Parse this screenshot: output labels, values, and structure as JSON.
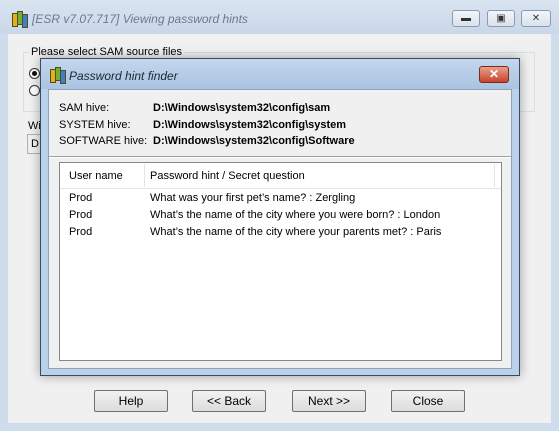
{
  "outer_window": {
    "title": "[ESR v7.07.717]  Viewing password hints",
    "group_label": "Please select SAM source files",
    "partial_label": "Wi",
    "partial_field": "D"
  },
  "dialog": {
    "title": "Password hint finder",
    "close_glyph": "✕",
    "hives": [
      {
        "label": "SAM hive:",
        "value": "D:\\Windows\\system32\\config\\sam"
      },
      {
        "label": "SYSTEM hive:",
        "value": "D:\\Windows\\system32\\config\\system"
      },
      {
        "label": "SOFTWARE hive:",
        "value": "D:\\Windows\\system32\\config\\Software"
      }
    ],
    "columns": [
      "User name",
      "Password hint / Secret question"
    ],
    "rows": [
      {
        "user": "Prod",
        "hint": "What was your first pet’s name? : Zergling"
      },
      {
        "user": "Prod",
        "hint": "What’s the name of the city where you were born? : London"
      },
      {
        "user": "Prod",
        "hint": "What’s the name of the city where your parents met? : Paris"
      }
    ]
  },
  "buttons": {
    "help": "Help",
    "back": "<< Back",
    "next": "Next >>",
    "close": "Close"
  },
  "window_controls": {
    "minimize": "▬",
    "maximize": "▣",
    "close": "✕"
  }
}
